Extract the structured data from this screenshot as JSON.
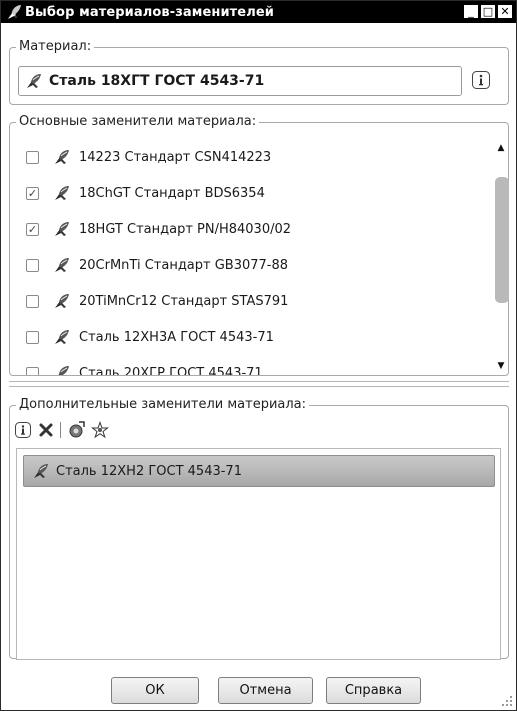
{
  "window": {
    "title": "Выбор материалов-заменителей",
    "minimize": "_",
    "maximize": "□",
    "close": "✕"
  },
  "material_group": {
    "legend": "Материал:",
    "value": "Сталь 18ХГТ ГОСТ 4543-71"
  },
  "main_group": {
    "legend": "Основные заменители материала:",
    "items": [
      {
        "label": "14223 Стандарт CSN414223",
        "checked": false
      },
      {
        "label": "18ChGT Стандарт BDS6354",
        "checked": true
      },
      {
        "label": "18HGT Стандарт PN/H84030/02",
        "checked": true
      },
      {
        "label": "20CrMnTi Стандарт GB3077-88",
        "checked": false
      },
      {
        "label": "20TiMnCr12 Стандарт STAS791",
        "checked": false
      },
      {
        "label": "Сталь 12ХН3А ГОСТ 4543-71",
        "checked": false
      },
      {
        "label": "Сталь 20ХГР ГОСТ 4543-71",
        "checked": false
      }
    ]
  },
  "extra_group": {
    "legend": "Дополнительные заменители материала:",
    "items": [
      {
        "label": "Сталь 12ХН2 ГОСТ 4543-71",
        "selected": true
      }
    ]
  },
  "buttons": {
    "ok": "ОК",
    "cancel": "Отмена",
    "help": "Справка"
  }
}
